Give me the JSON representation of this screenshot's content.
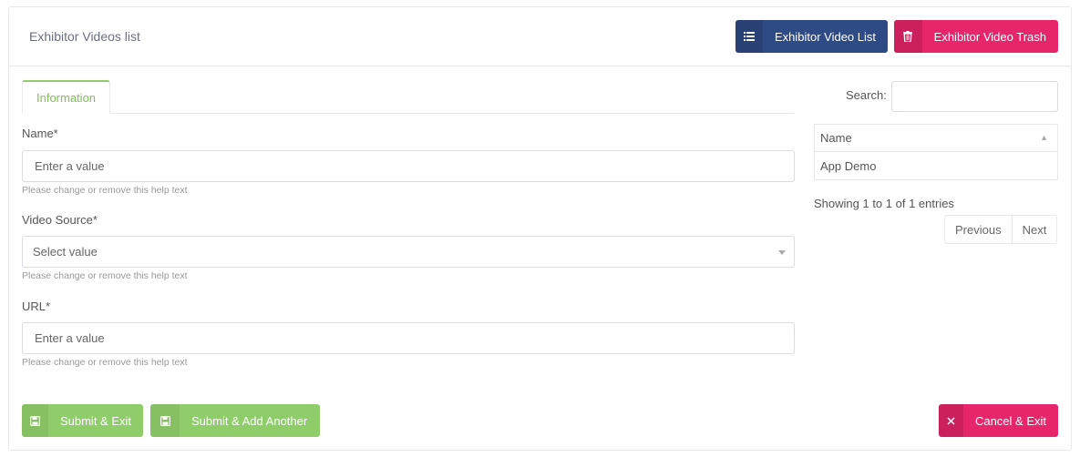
{
  "header": {
    "title": "Exhibitor Videos list",
    "list_button": "Exhibitor Video List",
    "trash_button": "Exhibitor Video Trash"
  },
  "tabs": [
    {
      "label": "Information"
    }
  ],
  "form": {
    "name": {
      "label": "Name*",
      "placeholder": "Enter a value",
      "help": "Please change or remove this help text"
    },
    "video_source": {
      "label": "Video Source*",
      "placeholder": "Select value",
      "help": "Please change or remove this help text"
    },
    "url": {
      "label": "URL*",
      "placeholder": "Enter a value",
      "help": "Please change or remove this help text"
    }
  },
  "sidebar": {
    "search_label": "Search:",
    "columns": [
      "Name"
    ],
    "rows": [
      [
        "App Demo"
      ]
    ],
    "info": "Showing 1 to 1 of 1 entries",
    "prev": "Previous",
    "next": "Next"
  },
  "footer": {
    "submit_exit": "Submit & Exit",
    "submit_add": "Submit & Add Another",
    "cancel_exit": "Cancel & Exit"
  },
  "colors": {
    "navy": "#2f4b86",
    "pink": "#e7256a",
    "green": "#8fcc6a"
  },
  "icons": {
    "list": "list-icon",
    "trash": "trash-icon",
    "save": "save-icon",
    "close": "close-icon"
  }
}
